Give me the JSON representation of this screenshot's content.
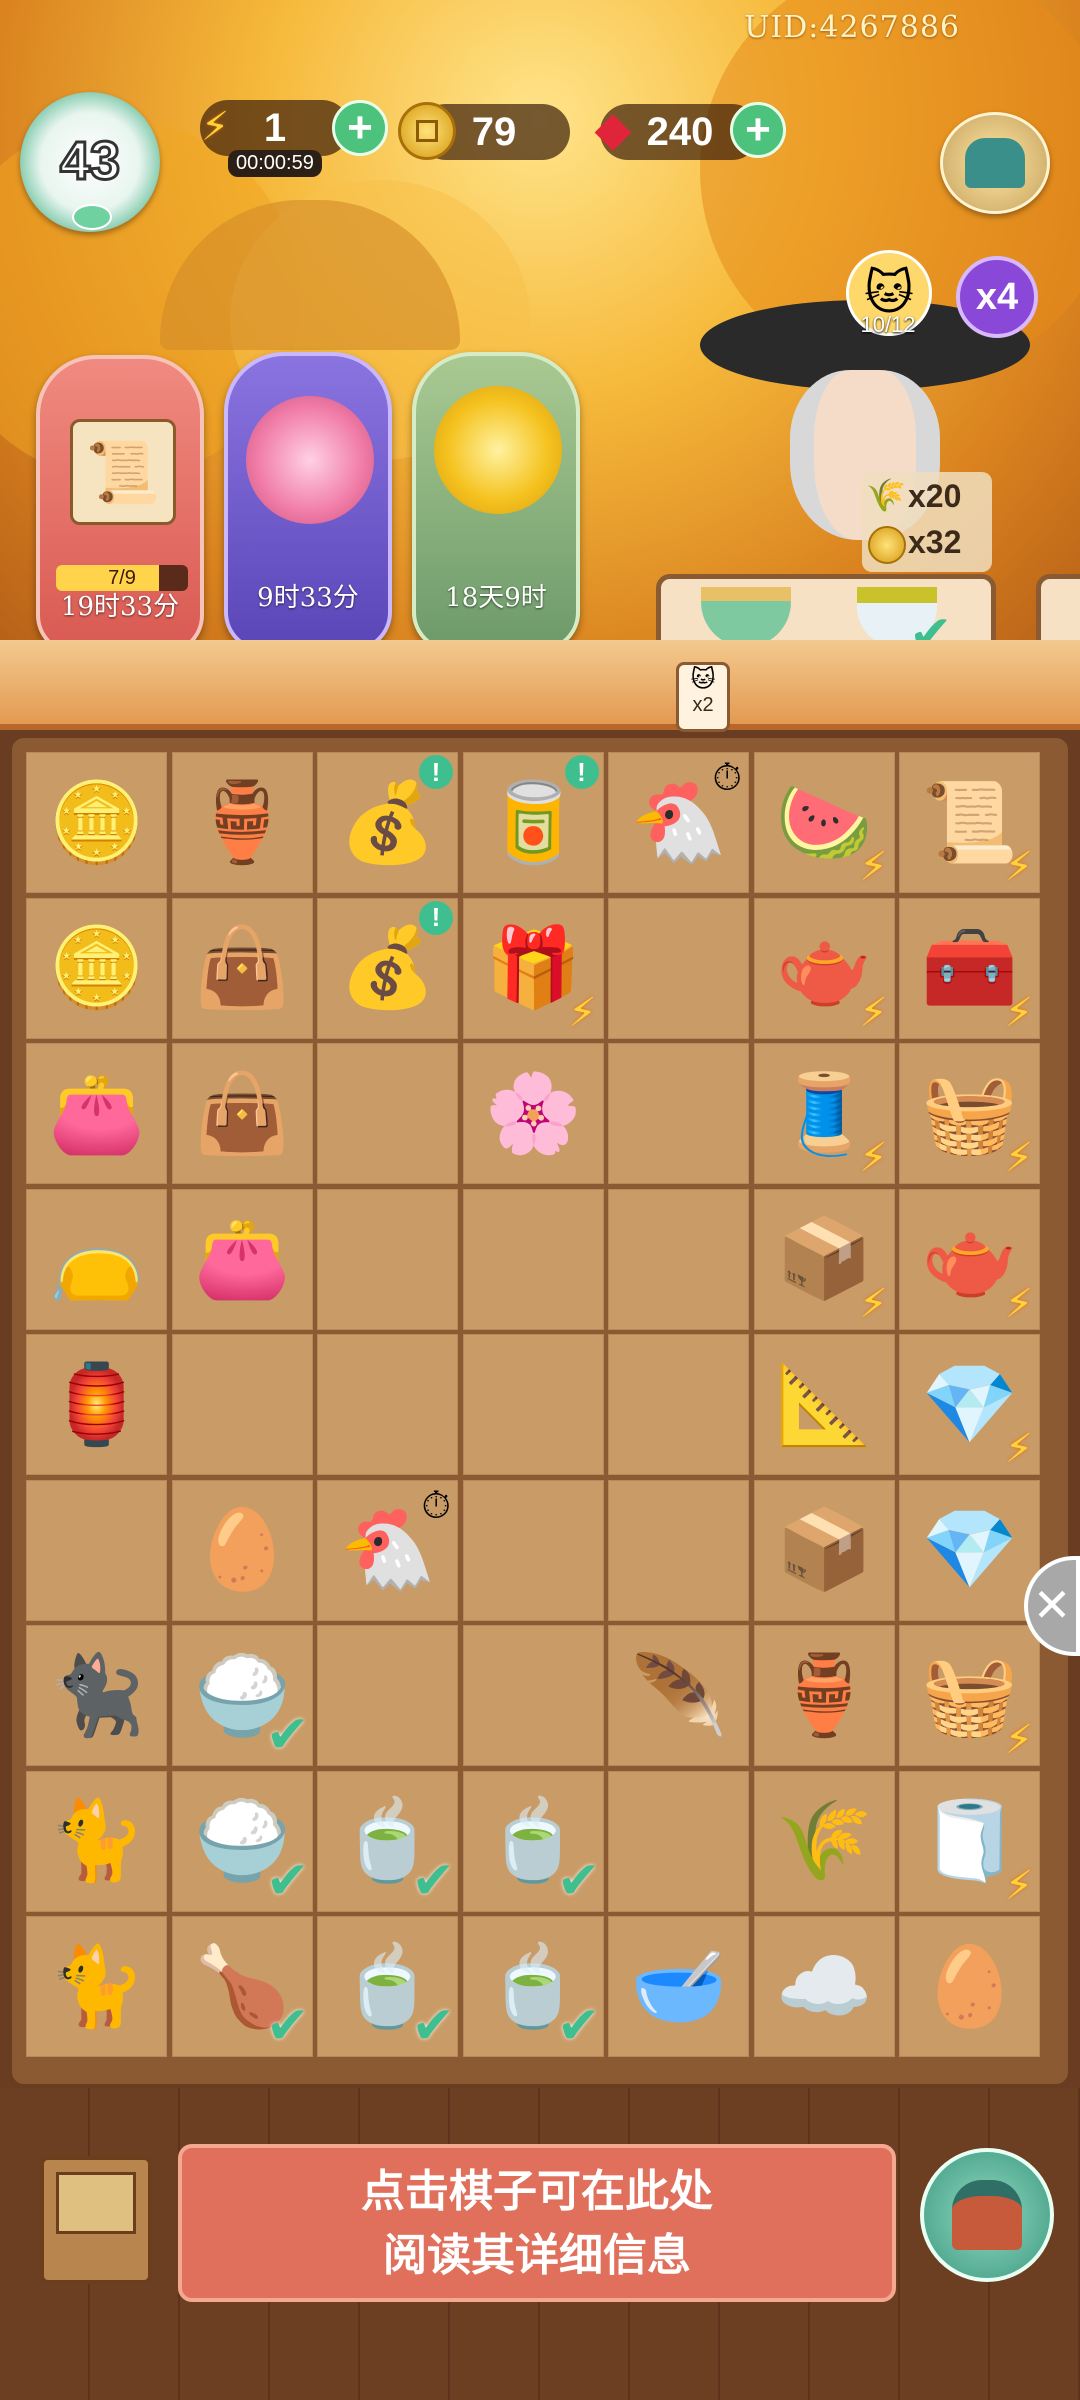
{
  "uid": "UID:4267886",
  "level": "43",
  "energy": {
    "value": "1",
    "timer": "00:00:59"
  },
  "coins": {
    "value": "79"
  },
  "gems": {
    "value": "240"
  },
  "events": [
    {
      "name": "scroll-event",
      "progress": "7/9",
      "time": "19时33分"
    },
    {
      "name": "peony-event",
      "time": "9时33分"
    },
    {
      "name": "chrysanthemum-event",
      "time": "18天9时"
    }
  ],
  "customer": {
    "orders_count": "10/12",
    "multiplier": "x4",
    "reward_wheat": "x20",
    "reward_coin": "x32",
    "cat_badge": "x2"
  },
  "board": {
    "rows": [
      [
        "coins-stack",
        "energy-gourd",
        "coin-bag",
        "red-box",
        "hen-nest",
        "fruit-crate",
        "scroll-crate"
      ],
      [
        "gold-coin",
        "purple-bag-large",
        "coin-pouch",
        "gift-box",
        "",
        "teapot-crate",
        "treasure-chest"
      ],
      [
        "purple-purse",
        "purple-bag",
        "",
        "flower-plate",
        "",
        "silk-loom",
        "sewing-basket"
      ],
      [
        "sachet",
        "small-purse",
        "",
        "",
        "",
        "scroll-box",
        "blue-teapot"
      ],
      [
        "lantern",
        "",
        "",
        "",
        "",
        "ruler-box",
        "jewel-chest"
      ],
      [
        "",
        "egg",
        "hen-nest",
        "",
        "",
        "wooden-box",
        "open-chest"
      ],
      [
        "black-cat",
        "corn-rice-bowl",
        "",
        "",
        "feather",
        "blue-jar",
        "harvest-basket"
      ],
      [
        "calico-cat",
        "corn-rice-bowl",
        "porcelain-bowl",
        "porcelain-bowl",
        "",
        "wheat-bundle",
        "loom-wheel"
      ],
      [
        "calico-cat-2",
        "roast-chicken-bowl",
        "tea-cup",
        "tea-cup",
        "soup-bowl",
        "cotton",
        "silk-cocoons"
      ]
    ]
  },
  "info_text_line1": "点击棋子可在此处",
  "info_text_line2": "阅读其详细信息",
  "colors": {
    "accent": "#e0705b",
    "board": "#c99b67",
    "check": "#3fbf8f"
  }
}
